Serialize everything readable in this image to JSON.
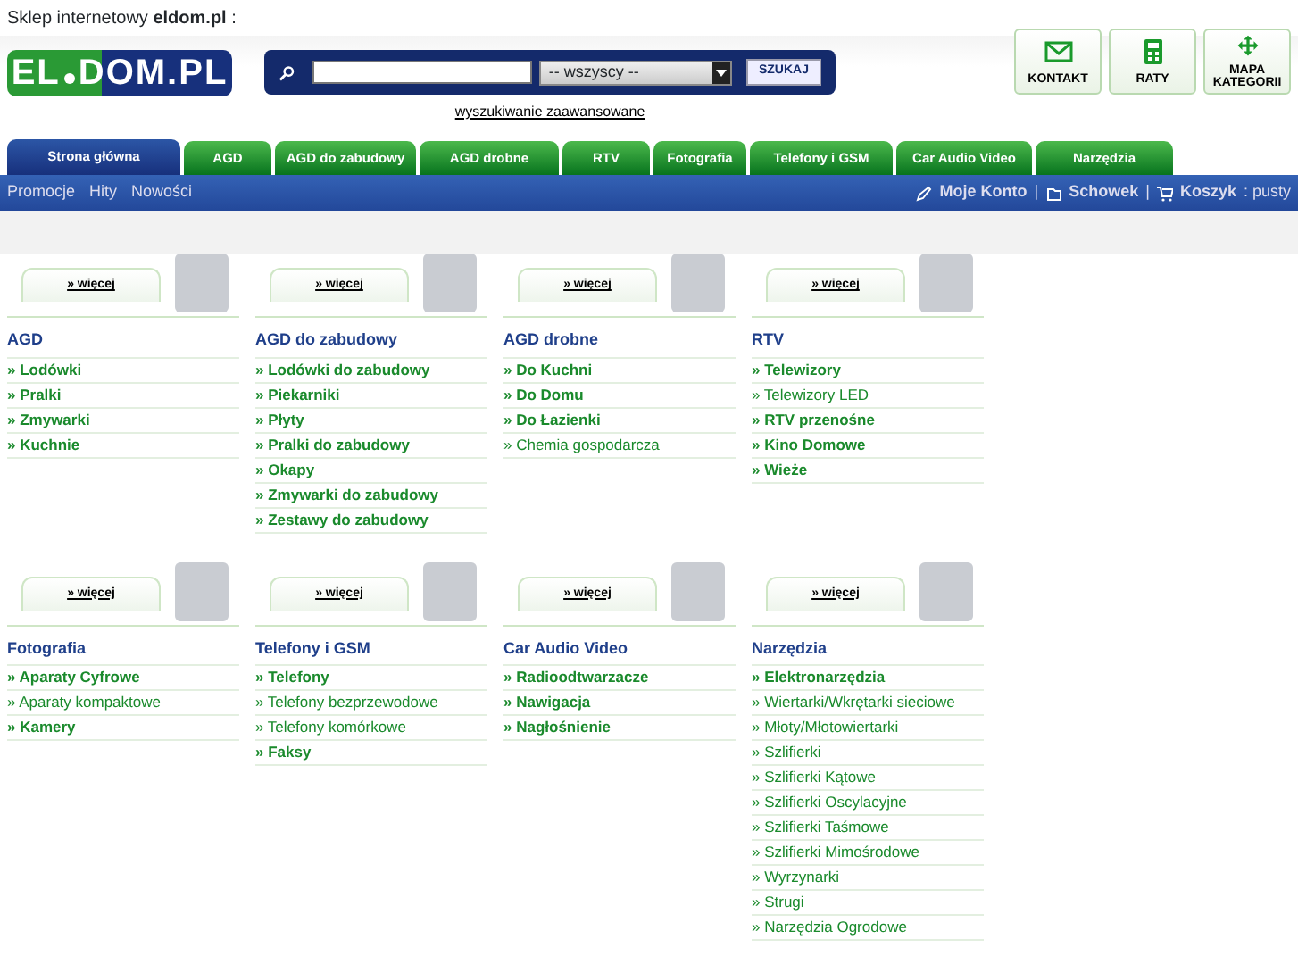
{
  "top_text": "Sklep internetowy **eldom.pl** :",
  "logo": {
    "left": "EL",
    "right": "DOM.PL"
  },
  "search": {
    "category": "-- wszyscy --",
    "button": "SZUKAJ",
    "advanced": "wyszukiwanie zaawansowane"
  },
  "header_buttons": [
    {
      "label": "KONTAKT",
      "kind": "mail"
    },
    {
      "label": "RATY",
      "kind": "calculator"
    },
    {
      "label": "MAPA KATEGORII",
      "kind": "move"
    }
  ],
  "tabs": [
    {
      "label": "Strona główna",
      "selected": true
    },
    {
      "label": "AGD",
      "selected": false
    },
    {
      "label": "AGD do zabudowy",
      "selected": false
    },
    {
      "label": "AGD drobne",
      "selected": false
    },
    {
      "label": "RTV",
      "selected": false
    },
    {
      "label": "Fotografia",
      "selected": false
    },
    {
      "label": "Telefony i GSM",
      "selected": false
    },
    {
      "label": "Car Audio Video",
      "selected": false
    },
    {
      "label": "Narzędzia",
      "selected": false
    }
  ],
  "sub_nav": [
    "Promocje",
    "Hity",
    "Nowości"
  ],
  "account": {
    "my_account": "Moje Konto",
    "separator": "|",
    "wishlist": "Schowek",
    "separator_2": "|",
    "cart": "Koszyk",
    "cart_status": ": pusty"
  },
  "category_rows": [
    [
      {
        "more": "» więcej",
        "title": "AGD",
        "items": [
          {
            "label": "» Lodówki",
            "bold": true
          },
          {
            "label": "» Pralki",
            "bold": true
          },
          {
            "label": "» Zmywarki",
            "bold": true
          },
          {
            "label": "» Kuchnie",
            "bold": true
          }
        ]
      },
      {
        "more": "» więcej",
        "title": "AGD do zabudowy",
        "items": [
          {
            "label": "» Lodówki do zabudowy",
            "bold": true
          },
          {
            "label": "» Piekarniki",
            "bold": true
          },
          {
            "label": "» Płyty",
            "bold": true
          },
          {
            "label": "» Pralki do zabudowy",
            "bold": true
          },
          {
            "label": "» Okapy",
            "bold": true
          },
          {
            "label": "» Zmywarki do zabudowy",
            "bold": true
          },
          {
            "label": "» Zestawy do zabudowy",
            "bold": true
          }
        ]
      },
      {
        "more": "» więcej",
        "title": "AGD drobne",
        "items": [
          {
            "label": "» Do Kuchni",
            "bold": true
          },
          {
            "label": "» Do Domu",
            "bold": true
          },
          {
            "label": "» Do Łazienki",
            "bold": true
          },
          {
            "label": "» Chemia gospodarcza",
            "bold": false
          }
        ]
      },
      {
        "more": "» więcej",
        "title": "RTV",
        "items": [
          {
            "label": "» Telewizory",
            "bold": true
          },
          {
            "label": "» Telewizory LED",
            "bold": false
          },
          {
            "label": "» RTV przenośne",
            "bold": true
          },
          {
            "label": "» Kino Domowe",
            "bold": true
          },
          {
            "label": "» Wieże",
            "bold": true
          }
        ]
      }
    ],
    [
      {
        "more": "» więcej",
        "title": "Fotografia",
        "items": [
          {
            "label": "» Aparaty Cyfrowe",
            "bold": true
          },
          {
            "label": "» Aparaty kompaktowe",
            "bold": false
          },
          {
            "label": "» Kamery",
            "bold": true
          }
        ]
      },
      {
        "more": "» więcej",
        "title": "Telefony i GSM",
        "items": [
          {
            "label": "» Telefony",
            "bold": true
          },
          {
            "label": "» Telefony bezprzewodowe",
            "bold": false
          },
          {
            "label": "» Telefony komórkowe",
            "bold": false
          },
          {
            "label": "» Faksy",
            "bold": true
          }
        ]
      },
      {
        "more": "» więcej",
        "title": "Car Audio Video",
        "items": [
          {
            "label": "» Radioodtwarzacze",
            "bold": true
          },
          {
            "label": "» Nawigacja",
            "bold": true
          },
          {
            "label": "» Nagłośnienie",
            "bold": true
          }
        ]
      },
      {
        "more": "» więcej",
        "title": "Narzędzia",
        "items": [
          {
            "label": "» Elektronarzędzia",
            "bold": true
          },
          {
            "label": "» Wiertarki/Wkrętarki sieciowe",
            "bold": false
          },
          {
            "label": "» Młoty/Młotowiertarki",
            "bold": false
          },
          {
            "label": "» Szlifierki",
            "bold": false
          },
          {
            "label": "» Szlifierki Kątowe",
            "bold": false
          },
          {
            "label": "» Szlifierki Oscylacyjne",
            "bold": false
          },
          {
            "label": "» Szlifierki Taśmowe",
            "bold": false
          },
          {
            "label": "» Szlifierki Mimośrodowe",
            "bold": false
          },
          {
            "label": "» Wyrzynarki",
            "bold": false
          },
          {
            "label": "» Strugi",
            "bold": false
          },
          {
            "label": "» Narzędzia Ogrodowe",
            "bold": false
          }
        ]
      }
    ]
  ]
}
